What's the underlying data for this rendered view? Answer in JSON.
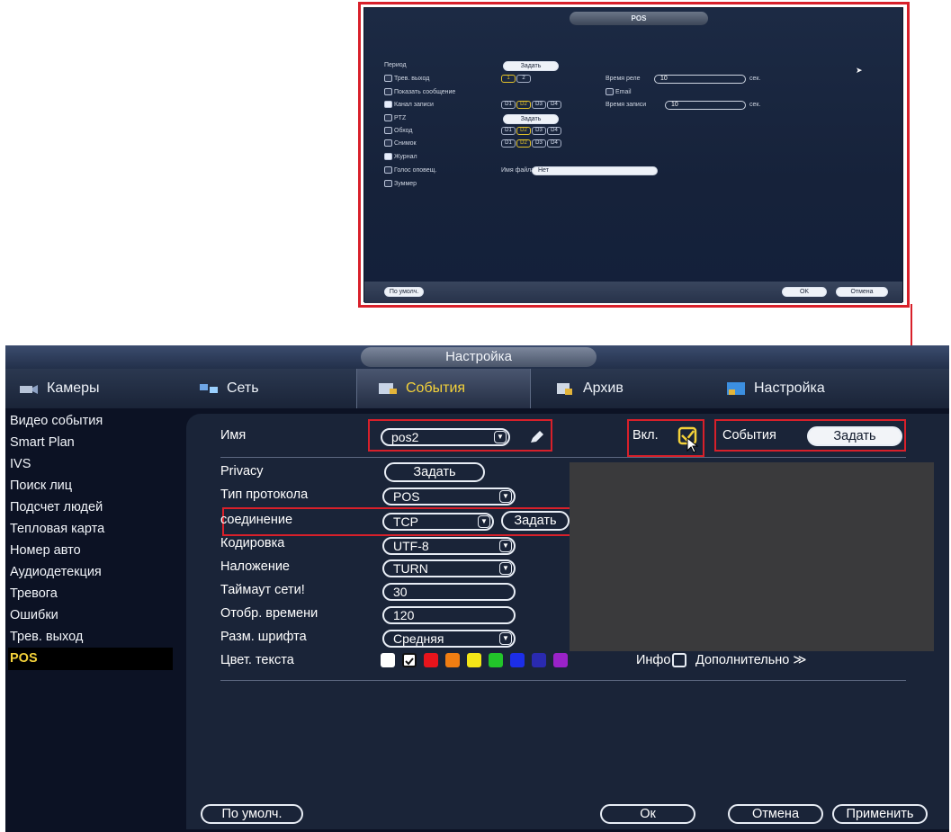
{
  "popup": {
    "title": "POS",
    "period_label": "Период",
    "period_button": "Задать",
    "alarm_out_label": "Трев. выход",
    "alarm_out_channels": [
      "1",
      "2"
    ],
    "relay_time_label": "Время реле",
    "relay_time_value": "10",
    "relay_time_unit": "сек.",
    "show_message_label": "Показать сообщение",
    "email_label": "Email",
    "record_channel_label": "Канал записи",
    "record_channels": [
      "D1",
      "D2",
      "D3",
      "D4"
    ],
    "record_time_label": "Время записи",
    "record_time_value": "10",
    "record_time_unit": "сек.",
    "ptz_label": "PTZ",
    "ptz_button": "Задать",
    "tour_label": "Обход",
    "tour_channels": [
      "D1",
      "D2",
      "D3",
      "D4"
    ],
    "snapshot_label": "Снимок",
    "snapshot_channels": [
      "D1",
      "D2",
      "D3",
      "D4"
    ],
    "log_label": "Журнал",
    "voice_label": "Голос оповещ.",
    "filename_label": "Имя файла",
    "filename_value": "Нет",
    "buzzer_label": "Зуммер",
    "default_button": "По умолч.",
    "ok_button": "OK",
    "cancel_button": "Отмена"
  },
  "main": {
    "title": "Настройка",
    "tabs": [
      {
        "label": "Камеры",
        "icon": "camera-icon"
      },
      {
        "label": "Сеть",
        "icon": "network-icon"
      },
      {
        "label": "События",
        "icon": "events-icon"
      },
      {
        "label": "Архив",
        "icon": "archive-icon"
      },
      {
        "label": "Настройка",
        "icon": "settings-icon"
      }
    ],
    "sidebar": [
      "Видео события",
      "Smart Plan",
      "IVS",
      "Поиск лиц",
      "Подсчет людей",
      "Тепловая карта",
      "Номер авто",
      "Аудиодетекция",
      "Тревога",
      "Ошибки",
      "Трев. выход",
      "POS"
    ],
    "form": {
      "name_label": "Имя",
      "name_value": "pos2",
      "enable_label": "Вкл.",
      "events_label": "События",
      "events_button": "Задать",
      "privacy_label": "Privacy",
      "privacy_button": "Задать",
      "protocol_label": "Тип протокола",
      "protocol_value": "POS",
      "connection_label": "соединение",
      "connection_value": "TCP",
      "connection_button": "Задать",
      "encoding_label": "Кодировка",
      "encoding_value": "UTF-8",
      "overlay_label": "Наложение",
      "overlay_value": "TURN",
      "timeout_label": "Таймаут сети!",
      "timeout_value": "30",
      "display_time_label": "Отобр. времени",
      "display_time_value": "120",
      "font_size_label": "Разм. шрифта",
      "font_size_value": "Средняя",
      "text_color_label": "Цвет. текста",
      "text_colors": [
        "#ffffff",
        "#ffffff",
        "#e8141c",
        "#f07d12",
        "#f4e617",
        "#22c52a",
        "#1c2ee8",
        "#2a2ab0",
        "#9a22c8"
      ],
      "info_label": "Инфо",
      "more_label": "Дополнительно ≫"
    },
    "buttons": {
      "default": "По умолч.",
      "ok": "Ок",
      "cancel": "Отмена",
      "apply": "Применить"
    }
  }
}
